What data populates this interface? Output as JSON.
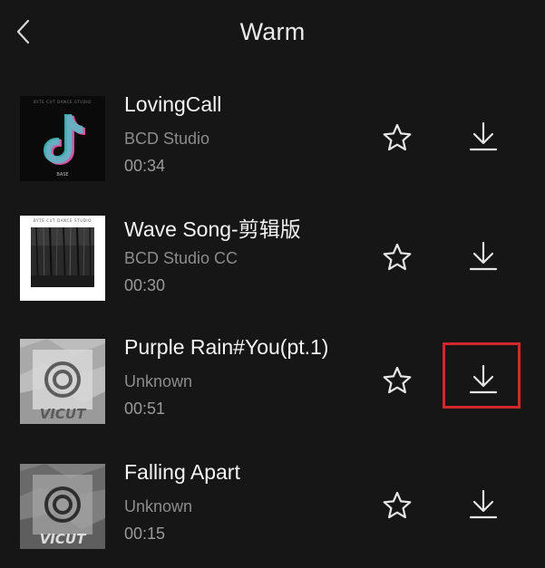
{
  "header": {
    "title": "Warm",
    "back_icon": "chevron-left-icon"
  },
  "songs": [
    {
      "title": "LovingCall",
      "artist": "BCD Studio",
      "duration": "00:34",
      "cover_text": "BASE",
      "cover_subtitle": "BYTE CUT DANCE STUDIO",
      "favorite_icon": "star-icon",
      "download_icon": "download-icon"
    },
    {
      "title": "Wave Song-剪辑版",
      "artist": "BCD Studio CC",
      "duration": "00:30",
      "cover_subtitle": "BYTE CUT DANCE STUDIO",
      "favorite_icon": "star-icon",
      "download_icon": "download-icon"
    },
    {
      "title": "Purple Rain#You(pt.1)",
      "artist": "Unknown",
      "duration": "00:51",
      "cover_text": "VICUT",
      "favorite_icon": "star-icon",
      "download_icon": "download-icon",
      "download_highlighted": true
    },
    {
      "title": "Falling Apart",
      "artist": "Unknown",
      "duration": "00:15",
      "cover_text": "VICUT",
      "favorite_icon": "star-icon",
      "download_icon": "download-icon"
    }
  ],
  "colors": {
    "background": "#161616",
    "title": "#e9e9e9",
    "secondary_text": "#8c8c8c",
    "icon": "#e6e6e6",
    "highlight": "#d3262c"
  }
}
